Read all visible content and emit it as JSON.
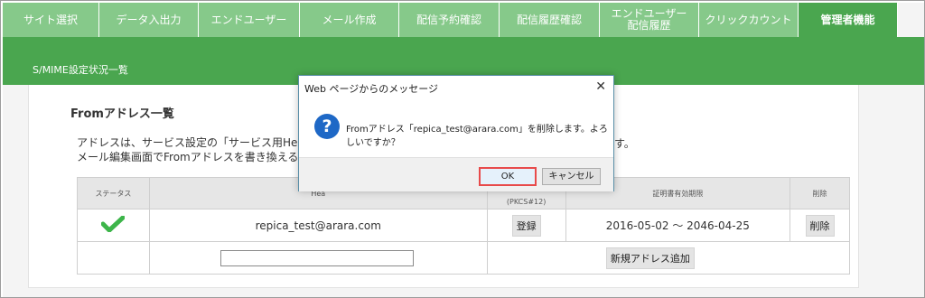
{
  "nav": {
    "items": [
      {
        "label": "サイト選択"
      },
      {
        "label": "データ入出力"
      },
      {
        "label": "エンドユーザー"
      },
      {
        "label": "メール作成"
      },
      {
        "label": "配信予約確認"
      },
      {
        "label": "配信履歴確認"
      },
      {
        "label": "エンドユーザー\n配信履歴"
      },
      {
        "label": "クリックカウント"
      },
      {
        "label": "管理者機能"
      }
    ]
  },
  "banner": {
    "title": "S/MIME設定状況一覧"
  },
  "section": {
    "title": "Fromアドレス一覧",
    "desc_line1": "アドレスは、サービス設定の「サービス用Header F",
    "desc_line2": "メール編集画面でFromアドレスを書き換える場合、",
    "desc_tail": "す。"
  },
  "table": {
    "headers": [
      "ステータス",
      "Hea",
      "(PKCS#12)",
      "証明書有効期限",
      "削除"
    ],
    "row": {
      "address": "repica_test@arara.com",
      "register_label": "登録",
      "validity": "2016-05-02 ～ 2046-04-25",
      "delete_label": "削除"
    },
    "add_label": "新規アドレス追加"
  },
  "dialog": {
    "title": "Web ページからのメッセージ",
    "message": "Fromアドレス「repica_test@arara.com」を削除します。よろしいですか？",
    "ok_label": "OK",
    "cancel_label": "キャンセル",
    "icon": "question-icon"
  },
  "colors": {
    "nav_inactive": "#86c98a",
    "nav_active": "#4aa64f",
    "check": "#3db54a",
    "highlight": "#e84a4a"
  }
}
